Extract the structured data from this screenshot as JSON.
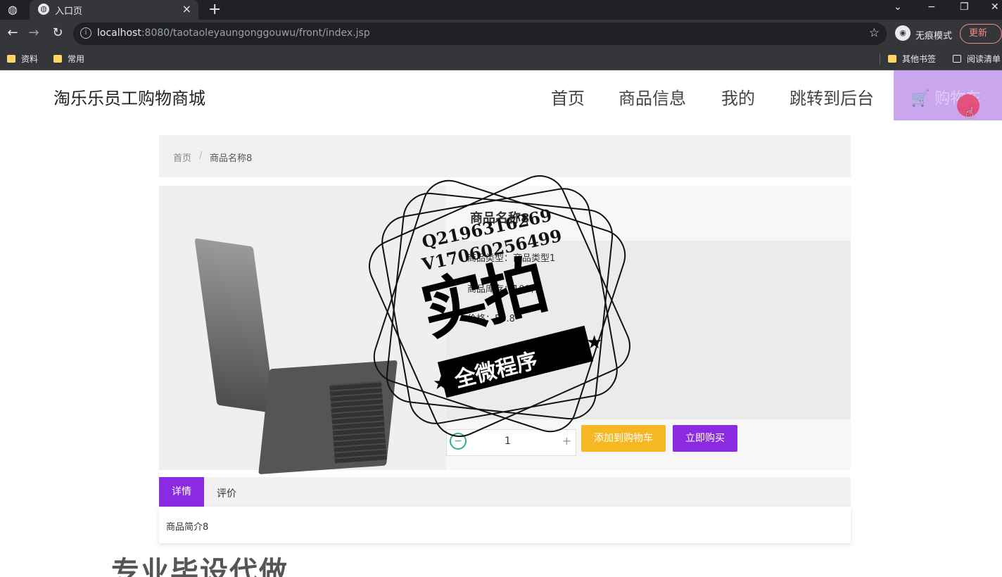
{
  "browser": {
    "tab_title": "入口页",
    "tab_close": "×",
    "new_tab": "+",
    "url_host": "localhost",
    "url_rest": ":8080/taotaoleyaungonggouwu/front/index.jsp",
    "incognito_label": "无痕模式",
    "update_label": "更新",
    "bookmarks": [
      "资料",
      "常用"
    ],
    "bookmarks_right": [
      "其他书签",
      "阅读清单"
    ]
  },
  "header": {
    "brand": "淘乐乐员工购物商城",
    "nav": [
      "首页",
      "商品信息",
      "我的",
      "跳转到后台"
    ],
    "cart_label": "购物车"
  },
  "breadcrumb": {
    "home": "首页",
    "separator": "/",
    "current": "商品名称8"
  },
  "product": {
    "name": "商品名称8",
    "type": "商品类型：商品类型1",
    "stock": "商品库存：100件",
    "price": "价格：56.8",
    "quantity": "1",
    "qty_minus": "−",
    "qty_plus": "+",
    "add_to_cart": "添加到购物车",
    "buy_now": "立即购买"
  },
  "tabs": {
    "detail": "详情",
    "review": "评价",
    "intro": "商品简介8"
  },
  "watermark": {
    "line1": "Q2196316269",
    "line2": "V17060256499",
    "main": "实拍",
    "ribbon": "全微程序",
    "bottom": "专业毕设代做"
  },
  "colors": {
    "accent": "#8a2be2",
    "cart_button": "#f6b822",
    "cart_box": "#c9a6ee"
  }
}
